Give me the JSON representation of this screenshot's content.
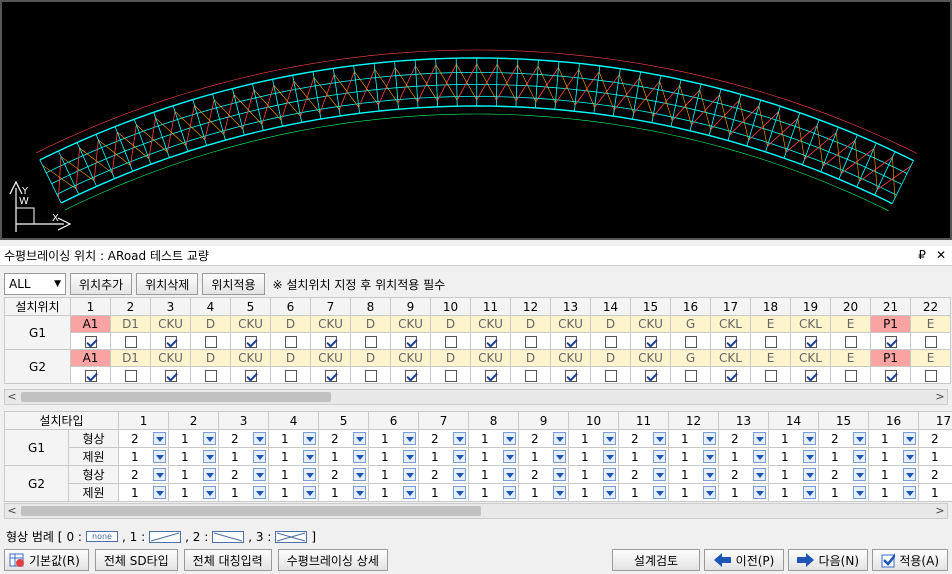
{
  "panel": {
    "title": "수평브레이싱 위치 : ARoad 테스트 교량",
    "pin": "₽",
    "close": "✕"
  },
  "toolbar": {
    "filter_value": "ALL",
    "add_label": "위치추가",
    "delete_label": "위치삭제",
    "apply_label": "위치적용",
    "note": "※ 설치위치 지정 후 위치적용 필수"
  },
  "position_table": {
    "header_label": "설치위치",
    "columns": [
      "1",
      "2",
      "3",
      "4",
      "5",
      "6",
      "7",
      "8",
      "9",
      "10",
      "11",
      "12",
      "13",
      "14",
      "15",
      "16",
      "17",
      "18",
      "19",
      "20",
      "21",
      "22"
    ],
    "rows": [
      {
        "name": "G1",
        "types": [
          "A1",
          "D1",
          "CKU",
          "D",
          "CKU",
          "D",
          "CKU",
          "D",
          "CKU",
          "D",
          "CKU",
          "D",
          "CKU",
          "D",
          "CKU",
          "G",
          "CKL",
          "E",
          "CKL",
          "E",
          "P1",
          "E"
        ],
        "checks": [
          true,
          false,
          true,
          false,
          true,
          false,
          true,
          false,
          true,
          false,
          true,
          false,
          true,
          false,
          true,
          false,
          true,
          false,
          true,
          false,
          true,
          false
        ]
      },
      {
        "name": "G2",
        "types": [
          "A1",
          "D1",
          "CKU",
          "D",
          "CKU",
          "D",
          "CKU",
          "D",
          "CKU",
          "D",
          "CKU",
          "D",
          "CKU",
          "D",
          "CKU",
          "G",
          "CKL",
          "E",
          "CKL",
          "E",
          "P1",
          "E"
        ],
        "checks": [
          true,
          false,
          true,
          false,
          true,
          false,
          true,
          false,
          true,
          false,
          true,
          false,
          true,
          false,
          true,
          false,
          true,
          false,
          true,
          false,
          true,
          false
        ]
      }
    ]
  },
  "type_table": {
    "header_label": "설치타입",
    "columns": [
      "1",
      "2",
      "3",
      "4",
      "5",
      "6",
      "7",
      "8",
      "9",
      "10",
      "11",
      "12",
      "13",
      "14",
      "15",
      "16",
      "17"
    ],
    "rows": [
      {
        "name": "G1",
        "shape_label": "형상",
        "shape": [
          "2",
          "1",
          "2",
          "1",
          "2",
          "1",
          "2",
          "1",
          "2",
          "1",
          "2",
          "1",
          "2",
          "1",
          "2",
          "1",
          "2"
        ],
        "spec_label": "제원",
        "spec": [
          "1",
          "1",
          "1",
          "1",
          "1",
          "1",
          "1",
          "1",
          "1",
          "1",
          "1",
          "1",
          "1",
          "1",
          "1",
          "1",
          "1"
        ]
      },
      {
        "name": "G2",
        "shape_label": "형상",
        "shape": [
          "2",
          "1",
          "2",
          "1",
          "2",
          "1",
          "2",
          "1",
          "2",
          "1",
          "2",
          "1",
          "2",
          "1",
          "2",
          "1",
          "2"
        ],
        "spec_label": "제원",
        "spec": [
          "1",
          "1",
          "1",
          "1",
          "1",
          "1",
          "1",
          "1",
          "1",
          "1",
          "1",
          "1",
          "1",
          "1",
          "1",
          "1",
          "1"
        ]
      }
    ]
  },
  "legend": {
    "label": "형상 범례 [",
    "k0": "0 :",
    "none_text": "none",
    "k1": ", 1 :",
    "k2": ", 2 :",
    "k3": ", 3 :",
    "end": "]"
  },
  "bottom": {
    "default_label": "기본값(R)",
    "all_sd_label": "전체 SD타입",
    "all_sym_label": "전체 대칭입력",
    "detail_label": "수평브레이싱 상세",
    "design_check_label": "설계검토",
    "prev_label": "이전(P)",
    "next_label": "다음(N)",
    "apply_label": "적용(A)"
  },
  "viewport": {
    "axis_y": "Y",
    "axis_x": "X",
    "axis_w": "W",
    "colors": {
      "deck": "#00ffff",
      "brace": "#ff4444",
      "line": "#00ff66"
    }
  }
}
